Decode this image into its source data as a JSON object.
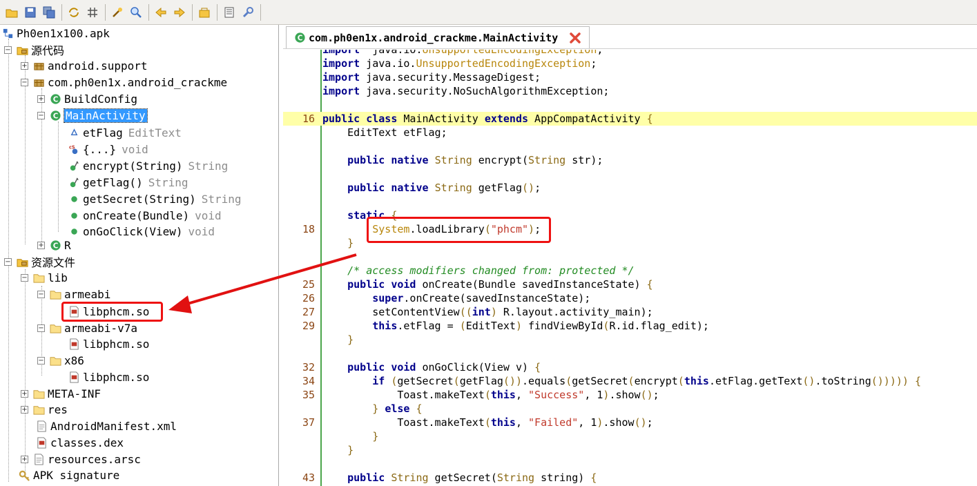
{
  "toolbar": {
    "buttons": [
      "open-icon",
      "save-icon",
      "save-all-icon",
      "sync-icon",
      "grid-icon",
      "wand-icon",
      "search-icon",
      "back-icon",
      "forward-icon",
      "export-icon",
      "log-icon",
      "settings-icon"
    ]
  },
  "tree": {
    "root": "Ph0en1x100.apk",
    "source_code": "源代码",
    "pkg_support": "android.support",
    "pkg_main": "com.ph0en1x.android_crackme",
    "buildconfig": "BuildConfig",
    "mainactivity": "MainActivity",
    "members": [
      {
        "name": "etFlag",
        "type": "EditText"
      },
      {
        "name": "{...}",
        "type": "void"
      },
      {
        "name": "encrypt(String)",
        "type": "String"
      },
      {
        "name": "getFlag()",
        "type": "String"
      },
      {
        "name": "getSecret(String)",
        "type": "String"
      },
      {
        "name": "onCreate(Bundle)",
        "type": "void"
      },
      {
        "name": "onGoClick(View)",
        "type": "void"
      }
    ],
    "r_class": "R",
    "resources": "资源文件",
    "lib": "lib",
    "armeabi": "armeabi",
    "libphcm1": "libphcm.so",
    "armeabi_v7a": "armeabi-v7a",
    "libphcm2": "libphcm.so",
    "x86": "x86",
    "libphcm3": "libphcm.so",
    "meta_inf": "META-INF",
    "res": "res",
    "manifest": "AndroidManifest.xml",
    "classes": "classes.dex",
    "arsc": "resources.arsc",
    "signature": "APK signature"
  },
  "editor": {
    "tab_title": "com.ph0en1x.android_crackme.MainActivity",
    "colors": {
      "keyword": "#00008b",
      "string": "#c0392b",
      "comment": "#228b22",
      "highlight": "#ffffa8",
      "annotation_red": "#e11111"
    },
    "lines": [
      {
        "n": "",
        "parts": [
          [
            "kw",
            "import"
          ],
          [
            "",
            "  java.io."
          ],
          [
            "ex",
            "UnsupportedEncodingException"
          ],
          [
            "",
            ";"
          ]
        ]
      },
      {
        "n": "",
        "parts": [
          [
            "kw",
            "import"
          ],
          [
            "",
            " java.io."
          ],
          [
            "ex",
            "UnsupportedEncodingException"
          ],
          [
            "",
            ";"
          ]
        ]
      },
      {
        "n": "",
        "parts": [
          [
            "kw",
            "import"
          ],
          [
            "",
            " java.security.MessageDigest;"
          ]
        ]
      },
      {
        "n": "",
        "parts": [
          [
            "kw",
            "import"
          ],
          [
            "",
            " java.security.NoSuchAlgorithmException;"
          ]
        ]
      },
      {
        "n": "",
        "parts": []
      },
      {
        "n": "16",
        "hl": true,
        "parts": [
          [
            "kw",
            "public class"
          ],
          [
            "",
            " MainActivity "
          ],
          [
            "kw",
            "extends"
          ],
          [
            "",
            " AppCompatActivity "
          ],
          [
            "ty",
            "{"
          ]
        ]
      },
      {
        "n": "",
        "parts": [
          [
            "",
            "    EditText etFlag;"
          ]
        ]
      },
      {
        "n": "",
        "parts": []
      },
      {
        "n": "",
        "parts": [
          [
            "",
            "    "
          ],
          [
            "kw",
            "public native"
          ],
          [
            "",
            " "
          ],
          [
            "ty",
            "String"
          ],
          [
            "",
            " encrypt("
          ],
          [
            "ty",
            "String"
          ],
          [
            "",
            " str);"
          ]
        ]
      },
      {
        "n": "",
        "parts": []
      },
      {
        "n": "",
        "parts": [
          [
            "",
            "    "
          ],
          [
            "kw",
            "public native"
          ],
          [
            "",
            " "
          ],
          [
            "ty",
            "String"
          ],
          [
            "",
            " getFlag"
          ],
          [
            "ty",
            "()"
          ],
          [
            "",
            ";"
          ]
        ]
      },
      {
        "n": "",
        "parts": []
      },
      {
        "n": "",
        "parts": [
          [
            "",
            "    "
          ],
          [
            "kw",
            "static"
          ],
          [
            "",
            " "
          ],
          [
            "ty",
            "{"
          ]
        ]
      },
      {
        "n": "18",
        "parts": [
          [
            "",
            "        "
          ],
          [
            "sysc",
            "System"
          ],
          [
            "",
            ".loadLibrary"
          ],
          [
            "ty",
            "("
          ],
          [
            "st",
            "\"phcm\""
          ],
          [
            "ty",
            ")"
          ],
          [
            "",
            ";"
          ]
        ]
      },
      {
        "n": "",
        "parts": [
          [
            "",
            "    "
          ],
          [
            "ty",
            "}"
          ]
        ]
      },
      {
        "n": "",
        "parts": []
      },
      {
        "n": "",
        "parts": [
          [
            "",
            "    "
          ],
          [
            "cm",
            "/* access modifiers changed from: protected */"
          ]
        ]
      },
      {
        "n": "25",
        "parts": [
          [
            "",
            "    "
          ],
          [
            "kw",
            "public void"
          ],
          [
            "",
            " onCreate(Bundle savedInstanceState) "
          ],
          [
            "ty",
            "{"
          ]
        ]
      },
      {
        "n": "26",
        "parts": [
          [
            "",
            "        "
          ],
          [
            "kw",
            "super"
          ],
          [
            "",
            ".onCreate(savedInstanceState);"
          ]
        ]
      },
      {
        "n": "27",
        "parts": [
          [
            "",
            "        setContentView"
          ],
          [
            "ty",
            "(("
          ],
          [
            "kw",
            "int"
          ],
          [
            "ty",
            ")"
          ],
          [
            "",
            " R.layout.activity_main);"
          ]
        ]
      },
      {
        "n": "29",
        "parts": [
          [
            "",
            "        "
          ],
          [
            "kw",
            "this"
          ],
          [
            "",
            ".etFlag = "
          ],
          [
            "ty",
            "("
          ],
          [
            "",
            "EditText"
          ],
          [
            "ty",
            ")"
          ],
          [
            "",
            " findViewById"
          ],
          [
            "ty",
            "("
          ],
          [
            "",
            "R.id.flag_edit);"
          ]
        ]
      },
      {
        "n": "",
        "parts": [
          [
            "",
            "    "
          ],
          [
            "ty",
            "}"
          ]
        ]
      },
      {
        "n": "",
        "parts": []
      },
      {
        "n": "32",
        "parts": [
          [
            "",
            "    "
          ],
          [
            "kw",
            "public void"
          ],
          [
            "",
            " onGoClick(View v) "
          ],
          [
            "ty",
            "{"
          ]
        ]
      },
      {
        "n": "34",
        "parts": [
          [
            "",
            "        "
          ],
          [
            "kw",
            "if"
          ],
          [
            "",
            " "
          ],
          [
            "ty",
            "("
          ],
          [
            "",
            "getSecret"
          ],
          [
            "ty",
            "("
          ],
          [
            "",
            "getFlag"
          ],
          [
            "ty",
            "())"
          ],
          [
            "",
            ".equals"
          ],
          [
            "ty",
            "("
          ],
          [
            "",
            "getSecret"
          ],
          [
            "ty",
            "("
          ],
          [
            "",
            "encrypt"
          ],
          [
            "ty",
            "("
          ],
          [
            "kw",
            "this"
          ],
          [
            "",
            ".etFlag.getText"
          ],
          [
            "ty",
            "()"
          ],
          [
            "",
            ".toString"
          ],
          [
            "ty",
            "()))))"
          ],
          [
            "",
            " "
          ],
          [
            "ty",
            "{"
          ]
        ]
      },
      {
        "n": "35",
        "parts": [
          [
            "",
            "            Toast.makeText"
          ],
          [
            "ty",
            "("
          ],
          [
            "kw",
            "this"
          ],
          [
            "",
            ", "
          ],
          [
            "st",
            "\"Success\""
          ],
          [
            "",
            ", 1"
          ],
          [
            "ty",
            ")"
          ],
          [
            "",
            ".show"
          ],
          [
            "ty",
            "()"
          ],
          [
            "",
            ";"
          ]
        ]
      },
      {
        "n": "",
        "parts": [
          [
            "",
            "        "
          ],
          [
            "ty",
            "}"
          ],
          [
            "",
            " "
          ],
          [
            "kw",
            "else"
          ],
          [
            "",
            " "
          ],
          [
            "ty",
            "{"
          ]
        ]
      },
      {
        "n": "37",
        "parts": [
          [
            "",
            "            Toast.makeText"
          ],
          [
            "ty",
            "("
          ],
          [
            "kw",
            "this"
          ],
          [
            "",
            ", "
          ],
          [
            "st",
            "\"Failed\""
          ],
          [
            "",
            ", 1"
          ],
          [
            "ty",
            ")"
          ],
          [
            "",
            ".show"
          ],
          [
            "ty",
            "()"
          ],
          [
            "",
            ";"
          ]
        ]
      },
      {
        "n": "",
        "parts": [
          [
            "",
            "        "
          ],
          [
            "ty",
            "}"
          ]
        ]
      },
      {
        "n": "",
        "parts": [
          [
            "",
            "    "
          ],
          [
            "ty",
            "}"
          ]
        ]
      },
      {
        "n": "",
        "parts": []
      },
      {
        "n": "43",
        "parts": [
          [
            "",
            "    "
          ],
          [
            "kw",
            "public"
          ],
          [
            "",
            " "
          ],
          [
            "ty",
            "String"
          ],
          [
            "",
            " getSecret("
          ],
          [
            "ty",
            "String"
          ],
          [
            "",
            " string) "
          ],
          [
            "ty",
            "{"
          ]
        ]
      }
    ]
  }
}
